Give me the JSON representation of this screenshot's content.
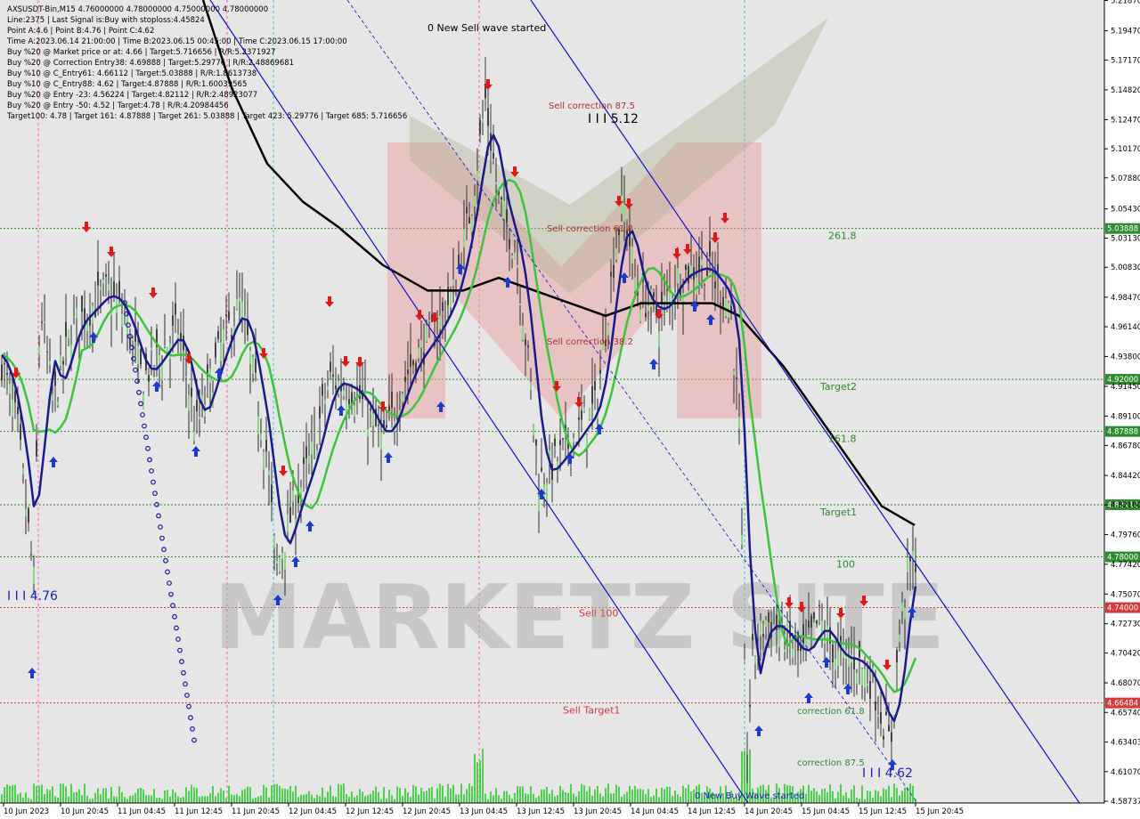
{
  "info_panel": [
    "AXSUSDT-Bin,M15  4.76000000 4.78000000 4.75000000 4.78000000",
    "Line:2375 | Last Signal is:Buy with stoploss:4.45824",
    "Point A:4.6 | Point B:4.76 | Point C:4.62",
    "Time A:2023.06.14 21:00:00 | Time B:2023.06.15 00:45:00 | Time C:2023.06.15 17:00:00",
    "Buy %20 @ Market price or at: 4.66 | Target:5.716656 | R/R:5.2371927",
    "Buy %20 @ Correction Entry38: 4.69888 | Target:5.29776 | R/R:2.48869681",
    "Buy %10 @ C_Entry61: 4.66112 | Target:5.03888 | R/R:1.8613738",
    "Buy %10 @ C_Entry88: 4.62 | Target:4.87888 | R/R:1.60039565",
    "Buy %20 @ Entry -23: 4.56224 | Target:4.82112 | R/R:2.48923077",
    "Buy %20 @ Entry -50: 4.52 | Target:4.78 | R/R:4.20984456",
    "Target100: 4.78 | Target 161: 4.87888 | Target 261: 5.03888 | Target 423: 5.29776 | Target 685: 5.716656"
  ],
  "chart_data": {
    "type": "candlestick",
    "symbol": "AXSUSDT-Bin",
    "timeframe": "M15",
    "ylim": [
      4.586,
      5.219
    ],
    "y_ticks": [
      5.2187,
      5.1947,
      5.1717,
      5.1482,
      5.1247,
      5.1017,
      5.0788,
      5.0543,
      5.0313,
      5.0083,
      4.9847,
      4.9614,
      4.938,
      4.9145,
      4.891,
      4.8678,
      4.8442,
      4.821,
      4.7976,
      4.7742,
      4.7507,
      4.7273,
      4.7042,
      4.6807,
      4.6574,
      4.63403,
      4.6107,
      4.58737
    ],
    "x_ticks": [
      "10 Jun 2023",
      "10 Jun 20:45",
      "11 Jun 04:45",
      "11 Jun 12:45",
      "11 Jun 20:45",
      "12 Jun 04:45",
      "12 Jun 12:45",
      "12 Jun 20:45",
      "13 Jun 04:45",
      "13 Jun 12:45",
      "13 Jun 20:45",
      "14 Jun 04:45",
      "14 Jun 12:45",
      "14 Jun 20:45",
      "15 Jun 04:45",
      "15 Jun 12:45",
      "15 Jun 20:45"
    ],
    "price_markers": [
      {
        "value": "5.03888",
        "y": 5.03888,
        "color": "#2e8b2e",
        "label": "261.8"
      },
      {
        "value": "4.92000",
        "y": 4.92,
        "color": "#2e8b2e",
        "label": "Target2"
      },
      {
        "value": "4.87888",
        "y": 4.87888,
        "color": "#2e8b2e",
        "label": "161.8"
      },
      {
        "value": "4.82112",
        "y": 4.82112,
        "color": "#2e8b2e",
        "label": "Target1"
      },
      {
        "value": "4.78000",
        "y": 4.78,
        "color": "#2e8b2e",
        "label": "100"
      },
      {
        "value": "4.74000",
        "y": 4.74,
        "color": "#d43c3c",
        "label": "Sell 100"
      },
      {
        "value": "4.66484",
        "y": 4.66484,
        "color": "#d43c3c",
        "label": "Sell Target1"
      }
    ],
    "annotations": [
      {
        "text": "0 New Sell wave started",
        "x": "12 Jun 20:45+",
        "y": 5.195,
        "color": "#000"
      },
      {
        "text": "Sell correction 87.5",
        "y": 5.123,
        "color": "#a33"
      },
      {
        "text": "I I I 5.12",
        "y": 5.112,
        "color": "#000"
      },
      {
        "text": "Sell correction 61.8",
        "y": 5.031,
        "color": "#a33"
      },
      {
        "text": "Sell correction 38.2",
        "y": 4.958,
        "color": "#a33"
      },
      {
        "text": "I I I 4.76",
        "y": 4.743,
        "color": "#2020c0"
      },
      {
        "text": "correction 61.8",
        "y": 4.655,
        "color": "#2e8b2e"
      },
      {
        "text": "correction 87.5",
        "y": 4.612,
        "color": "#2e8b2e"
      },
      {
        "text": "I I I 4.62",
        "y": 4.606,
        "color": "#2020c0"
      },
      {
        "text": "0 New Buy Wave started",
        "y": 4.59,
        "color": "#2020c0"
      }
    ],
    "series": [
      {
        "name": "",
        "color": "#000000",
        "type": "ma-slow"
      },
      {
        "name": "",
        "color": "#1a1a8c",
        "type": "ma-fast"
      },
      {
        "name": "",
        "color": "#3cc43c",
        "type": "ma-mid"
      }
    ],
    "channel_color": "#1010d0",
    "last_price": "4.78000",
    "watermark": "MARKETZ SITE"
  }
}
